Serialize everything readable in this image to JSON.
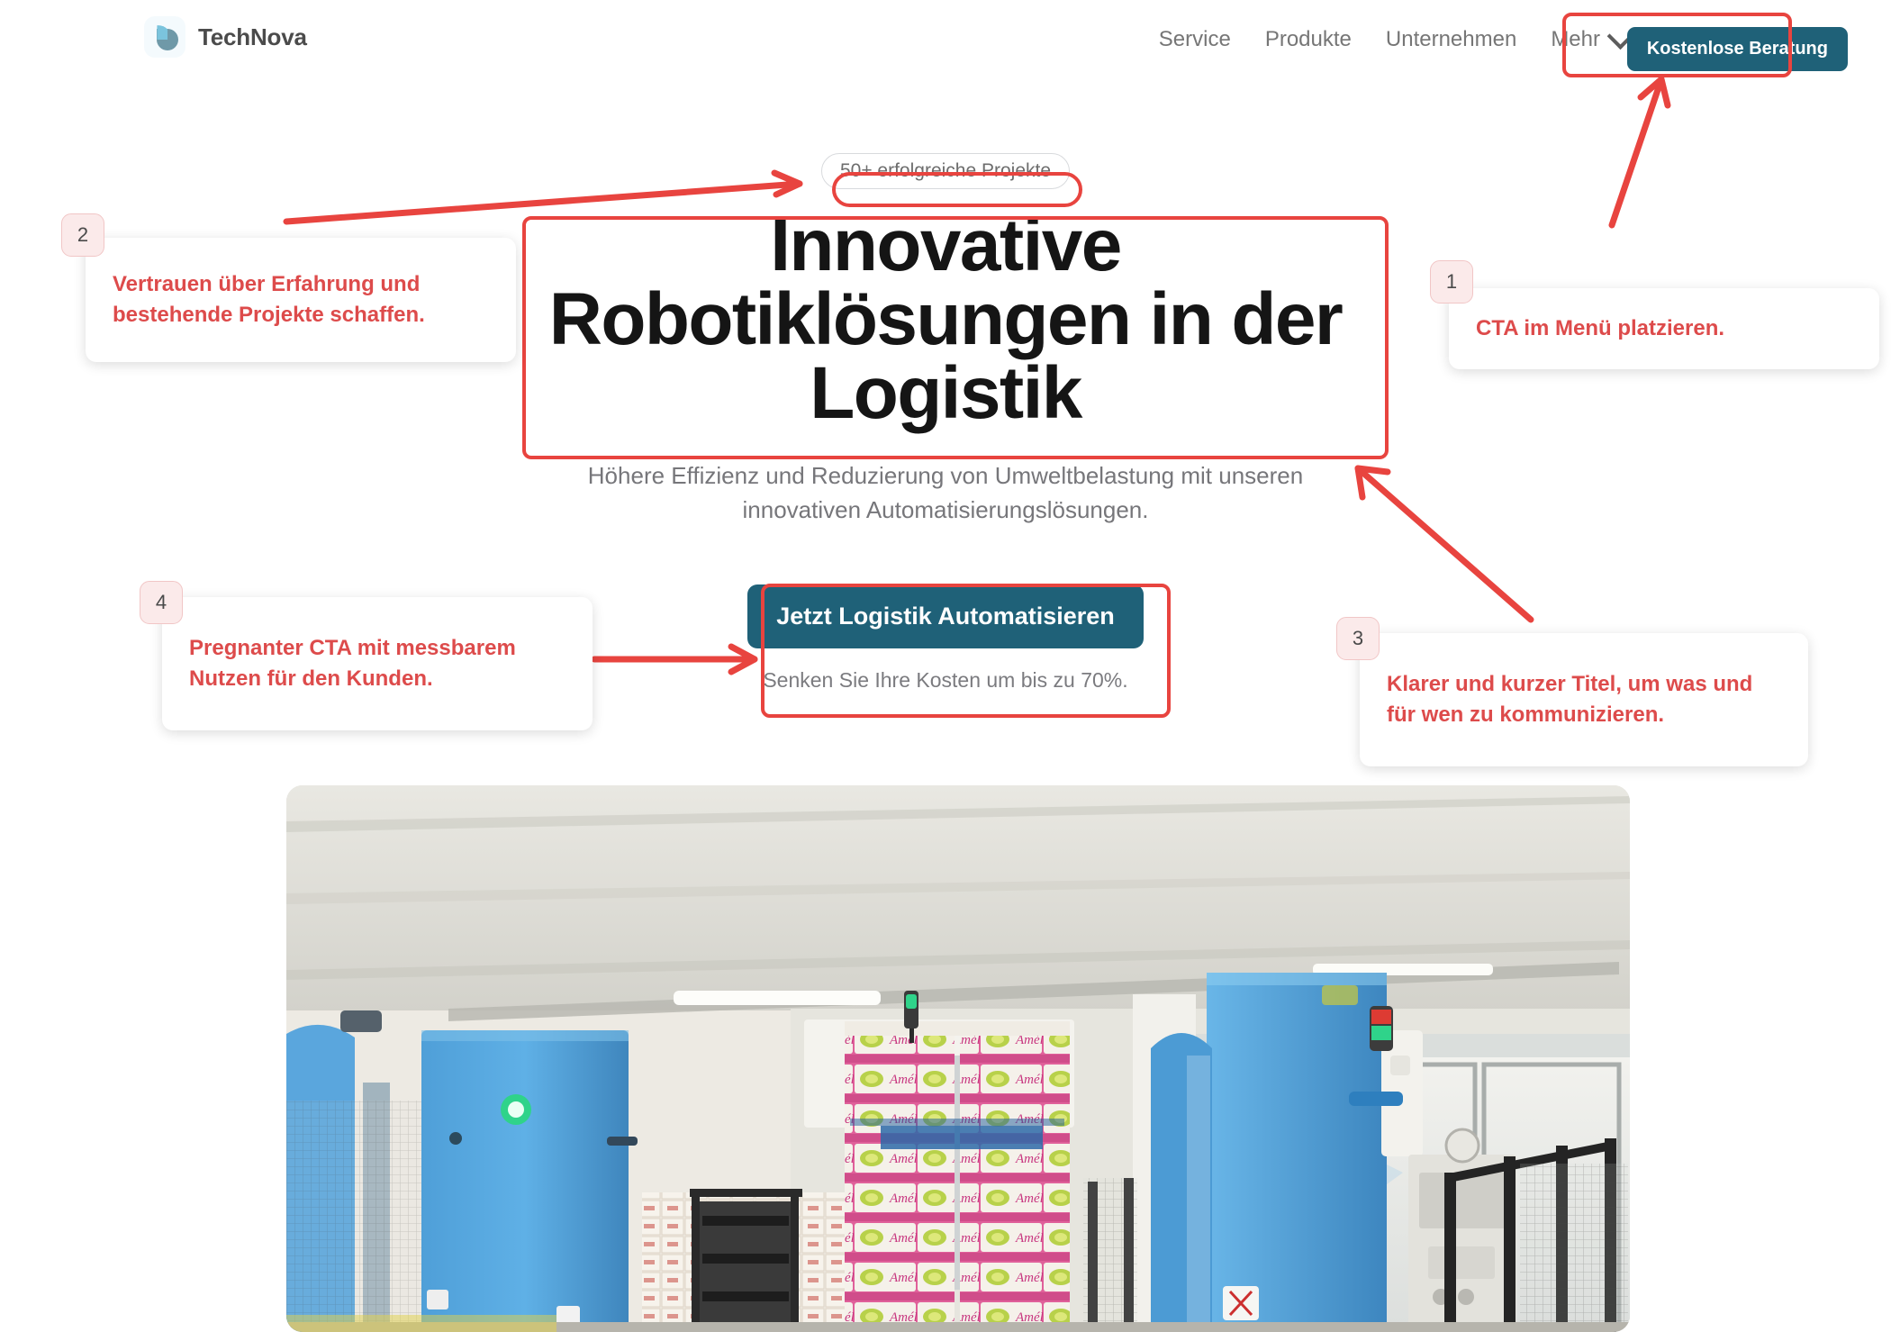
{
  "brand": {
    "name": "TechNova",
    "logo_icon": "droplet-pie-logo-icon"
  },
  "nav": {
    "items": [
      {
        "label": "Service"
      },
      {
        "label": "Produkte"
      },
      {
        "label": "Unternehmen"
      },
      {
        "label": "Mehr",
        "has_chevron": true
      }
    ],
    "cta_label": "Kostenlose Beratung"
  },
  "hero": {
    "badge": "50+ erfolgreiche Projekte",
    "title_lines": [
      "Innovative",
      "Robotiklösungen in der",
      "Logistik"
    ],
    "title_full": "Innovative Robotiklösungen in der Logistik",
    "subtitle": "Höhere Effizienz und Reduzierung von Umweltbelastung mit unseren innovativen Automatisierungslösungen.",
    "cta_label": "Jetzt Logistik Automatisieren",
    "cta_note": "Senken Sie Ihre Kosten um bis zu 70%.",
    "photo_alt": "Automatisierte Palettieranlage mit blauen Robotersäulen und rosa Amélie-Apfelkisten in einer Logistikhalle"
  },
  "annotations": [
    {
      "number": "1",
      "text": "CTA im Menü platzieren.",
      "target": "header-cta"
    },
    {
      "number": "2",
      "text": "Vertrauen über Erfahrung und bestehende Projekte schaffen.",
      "target": "hero-badge"
    },
    {
      "number": "3",
      "text": "Klarer und kurzer Titel, um was und für wen zu kommunizieren.",
      "target": "hero-title"
    },
    {
      "number": "4",
      "text": "Pregnanter CTA mit messbarem Nutzen für den Kunden.",
      "target": "hero-cta"
    }
  ],
  "colors": {
    "brand_teal": "#1f6178",
    "annotation_red": "#e8443f",
    "annotation_text_red": "#dd4b4b",
    "badge_bg": "#fbeaea",
    "nav_grey": "#767676",
    "title_black": "#151515",
    "sub_grey": "#76767a"
  }
}
